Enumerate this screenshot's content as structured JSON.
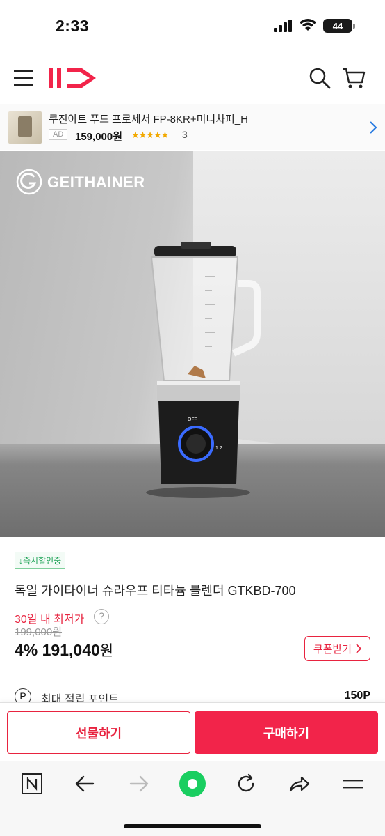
{
  "status": {
    "time": "2:33",
    "battery": "44"
  },
  "header": {
    "logo_text": "11",
    "brand_color": "#f2244a"
  },
  "ad": {
    "title": "쿠진아트 푸드 프로세서 FP-8KR+미니차퍼_H",
    "tag": "AD",
    "price": "159,000원",
    "stars": "★★★★★",
    "review_count": "3"
  },
  "hero": {
    "brand": "GEITHAINER",
    "registered": "®"
  },
  "product": {
    "badge": "↓즉시할인중",
    "name": "독일 가이타이너 슈라우프 티타늄 블렌더 GTKBD-700",
    "lowest_label": "30일 내 최저가",
    "help": "?",
    "original_price": "199,000원",
    "discount_pct": "4%",
    "price": "191,040",
    "won": "원",
    "coupon_label": "쿠폰받기",
    "points_icon": "P",
    "points_label": "최대 적립 포인트",
    "points_value": "150P"
  },
  "actions": {
    "gift_label": "선물하기",
    "buy_label": "구매하기"
  },
  "toolbar": {
    "icons": [
      "naver-home-icon",
      "back-arrow-icon",
      "forward-arrow-icon",
      "green-dot-icon",
      "reload-icon",
      "share-icon",
      "menu-icon"
    ]
  }
}
